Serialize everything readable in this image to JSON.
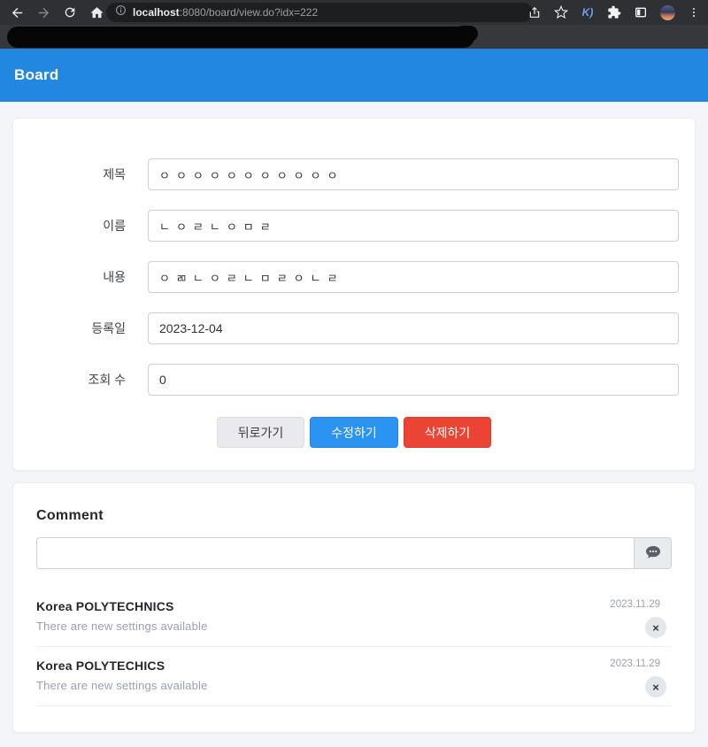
{
  "browser": {
    "url": {
      "host": "localhost",
      "rest": ":8080/board/view.do?idx=222"
    },
    "extension_label": "K)"
  },
  "header": {
    "title": "Board"
  },
  "form": {
    "rows": [
      {
        "label": "제목",
        "value": "ㅇㅇㅇㅇㅇㅇㅇㅇㅇㅇㅇ"
      },
      {
        "label": "이름",
        "value": "ㄴㅇㄹㄴㅇㅁㄹ"
      },
      {
        "label": "내용",
        "value": "ㅇㄻㄴㅇㄹㄴㅁㄹㅇㄴㄹ"
      },
      {
        "label": "등록일",
        "value": "2023-12-04"
      },
      {
        "label": "조회 수",
        "value": "0"
      }
    ],
    "buttons": {
      "back": "뒤로가기",
      "edit": "수정하기",
      "delete": "삭제하기"
    }
  },
  "comments": {
    "title": "Comment",
    "input_value": "",
    "close_glyph": "×",
    "items": [
      {
        "author": "Korea POLYTECHNICS",
        "text": "There are new settings available",
        "date": "2023.11.29"
      },
      {
        "author": "Korea POLYTECHICS",
        "text": "There are new settings available",
        "date": "2023.11.29"
      }
    ]
  },
  "colors": {
    "header_blue": "#2287e1",
    "edit_blue": "#2b93f2",
    "delete_red": "#eb4434",
    "page_bg": "#f4f5f9"
  }
}
